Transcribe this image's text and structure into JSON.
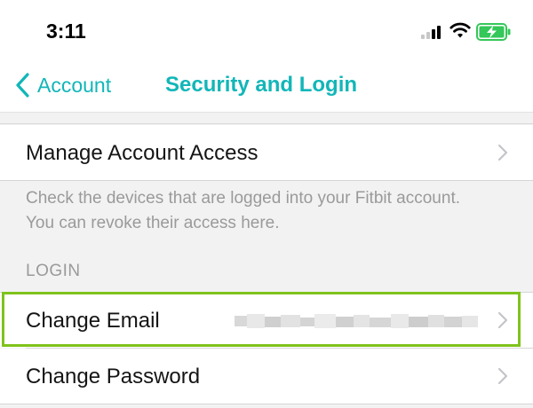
{
  "status_bar": {
    "time": "3:11",
    "signal_icon": "cellular-signal-icon",
    "wifi_icon": "wifi-icon",
    "battery_icon": "battery-charging-icon",
    "battery_color": "#34c759"
  },
  "navbar": {
    "back_label": "Account",
    "title": "Security and Login",
    "accent_color": "#12b6b8"
  },
  "account_access": {
    "label": "Manage Account Access",
    "footer": "Check the devices that are logged into your Fitbit account. You can revoke their access here."
  },
  "login_section": {
    "header": "LOGIN",
    "change_email_label": "Change Email",
    "change_email_value_redacted": true,
    "change_password_label": "Change Password",
    "highlight_color": "#7fc31c"
  }
}
